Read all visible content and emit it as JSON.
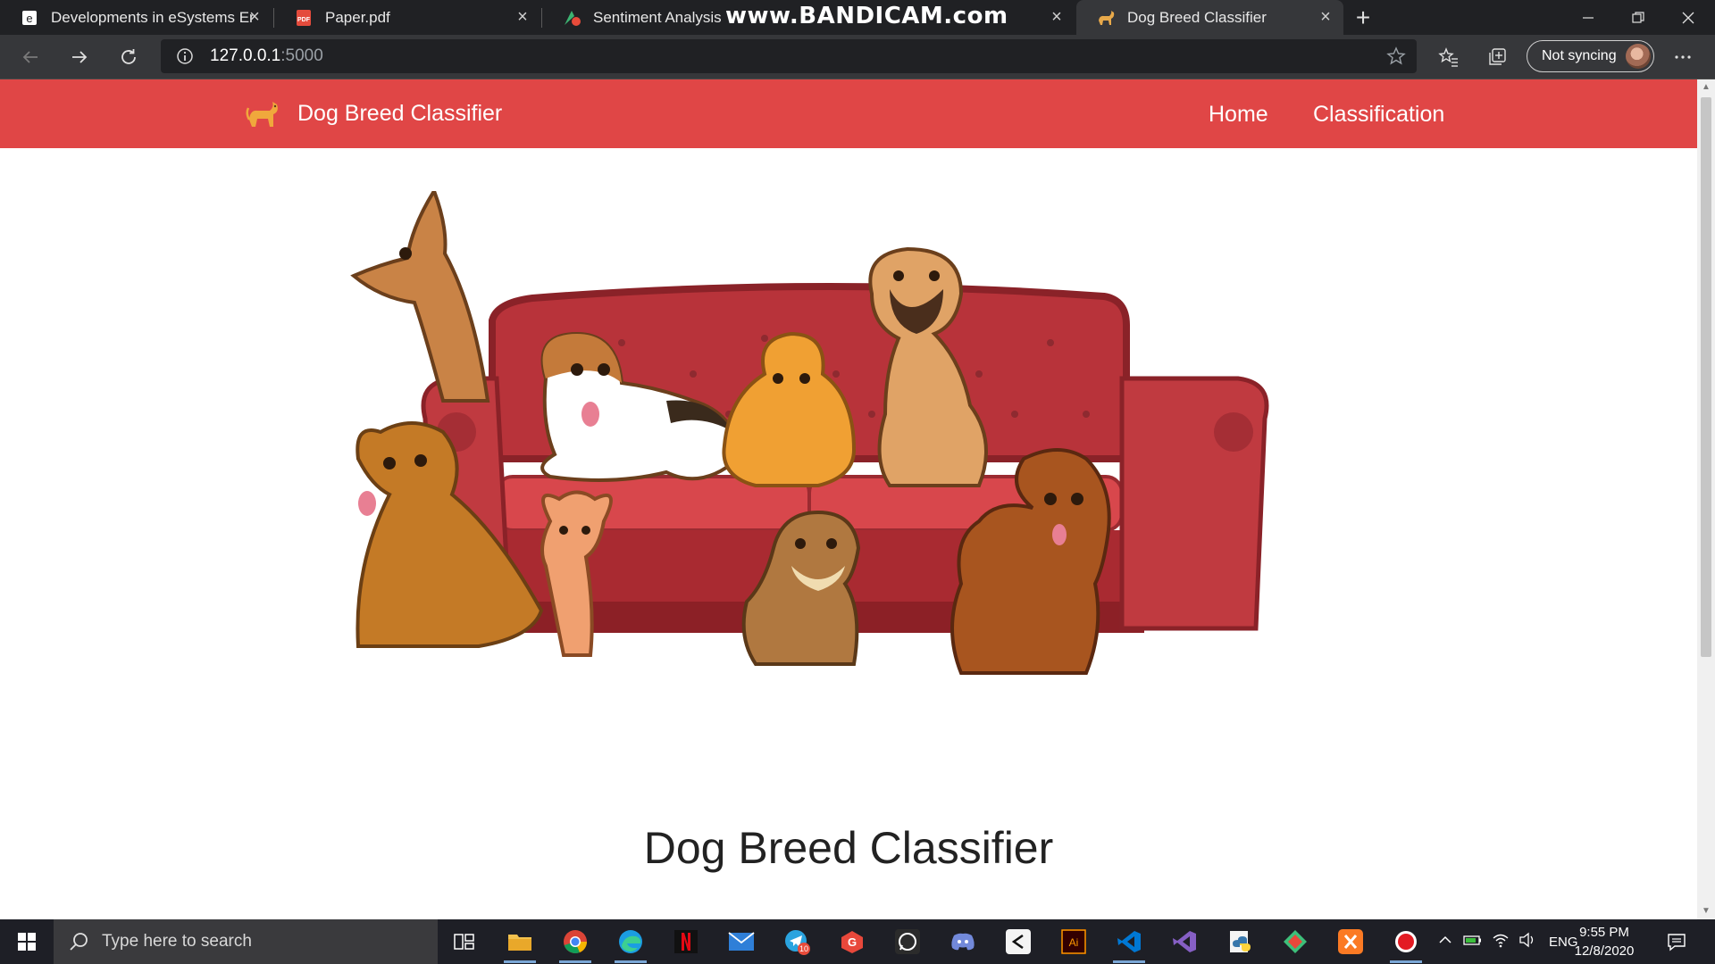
{
  "browser": {
    "tabs": [
      {
        "title": "Developments in eSystems Engir",
        "icon": "edge-doc-icon",
        "active": false
      },
      {
        "title": "Paper.pdf",
        "icon": "pdf-icon",
        "active": false
      },
      {
        "title": "Sentiment Analysis",
        "icon": "sentiment-app-icon",
        "active": false
      },
      {
        "title": "Dog Breed Classifier",
        "icon": "dog-icon",
        "active": true
      }
    ],
    "watermark": "www.BANDICAM.com",
    "address": {
      "host": "127.0.0.1",
      "port": ":5000"
    },
    "sync_label": "Not syncing"
  },
  "site": {
    "brand": "Dog Breed Classifier",
    "nav": {
      "home": "Home",
      "classification": "Classification"
    },
    "heading": "Dog Breed Classifier",
    "colors": {
      "navbar": "#e04646"
    }
  },
  "taskbar": {
    "search_placeholder": "Type here to search",
    "apps": [
      "task-view",
      "file-explorer",
      "chrome",
      "edge",
      "netflix",
      "mail",
      "telegram",
      "grammarly",
      "whatsapp",
      "discord",
      "capcut",
      "illustrator",
      "vscode",
      "visual-studio",
      "python-idle",
      "git-kraken",
      "xampp",
      "bandicam"
    ],
    "telegram_badge": "10",
    "language": "ENG",
    "time": "9:55 PM",
    "date": "12/8/2020"
  }
}
